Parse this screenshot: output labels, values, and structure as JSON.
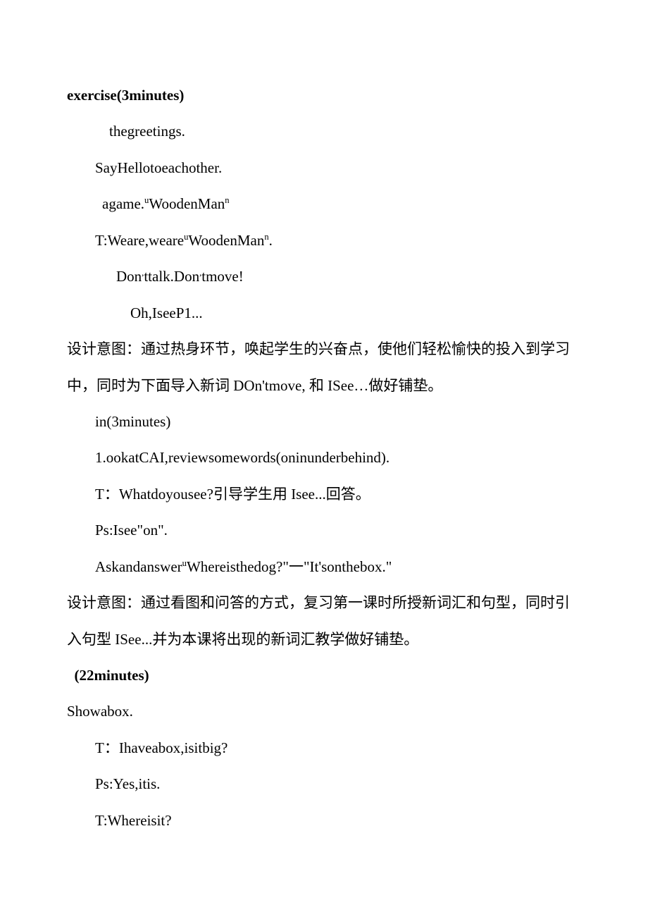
{
  "lines": [
    {
      "class": "bold",
      "indent": "indent-0",
      "text": "exercise(3minutes)"
    },
    {
      "class": "",
      "indent": "indent-1",
      "text": "thegreetings."
    },
    {
      "class": "",
      "indent": "indent-2",
      "text": "SayHellotoeachother."
    },
    {
      "class": "",
      "indent": "indent-5",
      "html": "agame.<sup class=\"small\">u</sup>WoodenMan<sup class=\"small\">n</sup>"
    },
    {
      "class": "",
      "indent": "indent-2",
      "html": "T:Weare,weare<sup class=\"small\">u</sup>WoodenMan<sup class=\"small\">n</sup>."
    },
    {
      "class": "",
      "indent": "indent-3",
      "html": "Don<sup class=\"small\">,</sup>ttalk.Don<sup class=\"small\">,</sup>tmove!"
    },
    {
      "class": "",
      "indent": "indent-4",
      "text": "Oh,IseeP1..."
    },
    {
      "class": "",
      "indent": "indent-0",
      "text": "设计意图：通过热身环节，唤起学生的兴奋点，使他们轻松愉快的投入到学习中，同时为下面导入新词 DOn'tmove, 和 ISee…做好铺垫。"
    },
    {
      "class": "",
      "indent": "indent-2",
      "text": "in(3minutes)"
    },
    {
      "class": "",
      "indent": "indent-2",
      "text": "1.ookatCAI,reviewsomewords(oninunderbehind)."
    },
    {
      "class": "",
      "indent": "indent-2",
      "text": "T：Whatdoyousee?引导学生用 Isee...回答。"
    },
    {
      "class": "",
      "indent": "indent-2",
      "text": "Ps:Isee\"on\"."
    },
    {
      "class": "",
      "indent": "indent-2",
      "html": "Askandanswer<sup class=\"small\">u</sup>Whereisthedog?\"一\"It'sonthebox.\""
    },
    {
      "class": "",
      "indent": "indent-0",
      "text": "设计意图：通过看图和问答的方式，复习第一课时所授新词汇和句型，同时引入句型 ISee...并为本课将出现的新词汇教学做好铺垫。"
    },
    {
      "class": "bold",
      "indent": "indent-0",
      "text": "  (22minutes)"
    },
    {
      "class": "",
      "indent": "indent-0",
      "text": "Showabox."
    },
    {
      "class": "",
      "indent": "indent-2",
      "text": "T：Ihaveabox,isitbig?"
    },
    {
      "class": "",
      "indent": "indent-2",
      "text": "Ps:Yes,itis."
    },
    {
      "class": "",
      "indent": "indent-2",
      "text": "T:Whereisit?"
    }
  ]
}
